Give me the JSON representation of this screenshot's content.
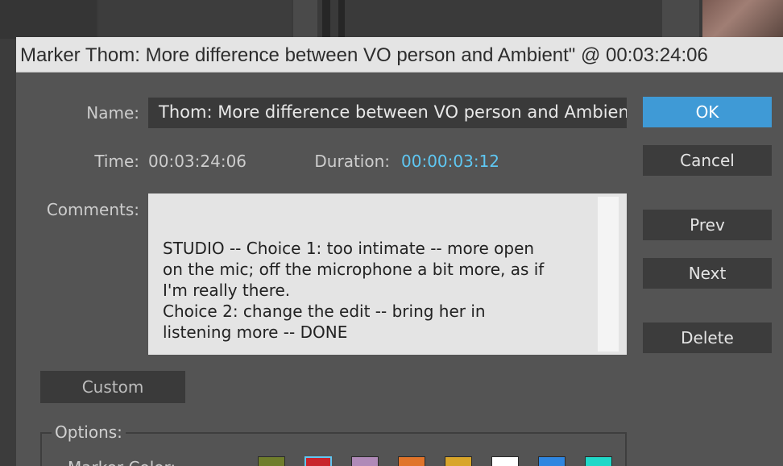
{
  "dialog": {
    "title": "Marker Thom: More difference between VO person and Ambient\" @ 00:03:24:06"
  },
  "name": {
    "label": "Name:",
    "value": "Thom: More difference between VO person and Ambient\""
  },
  "time": {
    "label": "Time:",
    "value": "00:03:24:06"
  },
  "duration": {
    "label": "Duration:",
    "value": "00:00:03:12"
  },
  "comments": {
    "label": "Comments:",
    "value": "STUDIO -- Choice 1: too intimate -- more open\non the mic; off the microphone a bit more, as if\nI'm really there.\nChoice 2: change the edit -- bring her in\nlistening more -- DONE"
  },
  "buttons": {
    "ok": "OK",
    "cancel": "Cancel",
    "prev": "Prev",
    "next": "Next",
    "delete": "Delete",
    "custom": "Custom"
  },
  "options": {
    "legend": "Options:",
    "marker_color_label": "Marker Color:",
    "swatches": [
      {
        "color": "#6f7d2c",
        "selected": false
      },
      {
        "color": "#c8242c",
        "selected": true
      },
      {
        "color": "#b08ab8",
        "selected": false
      },
      {
        "color": "#e0742a",
        "selected": false
      },
      {
        "color": "#d8a52a",
        "selected": false
      },
      {
        "color": "#ffffff",
        "selected": false
      },
      {
        "color": "#2f86e0",
        "selected": false
      },
      {
        "color": "#20d8c8",
        "selected": false
      }
    ]
  },
  "colors": {
    "accent": "#5fc7f2",
    "ok_button": "#3f9ad6",
    "dialog_bg": "#545454"
  }
}
